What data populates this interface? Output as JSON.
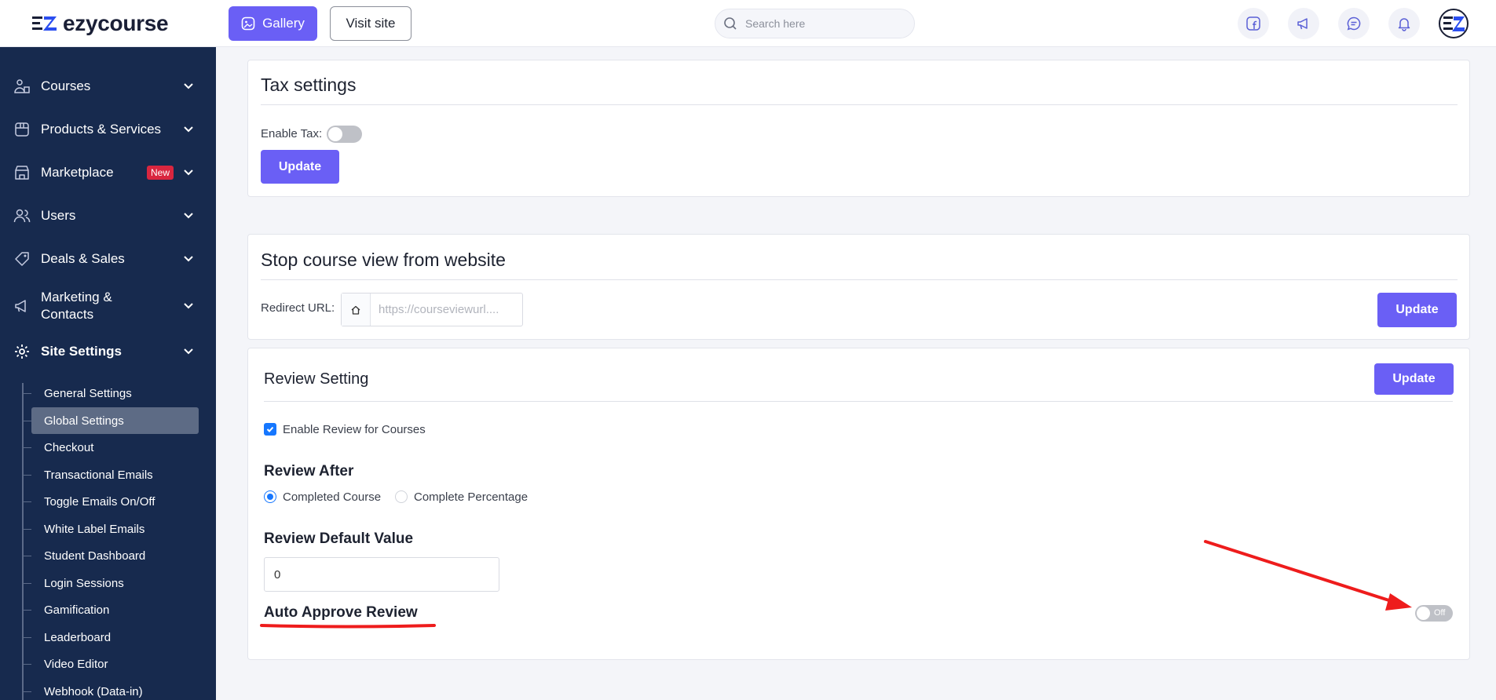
{
  "brand": {
    "name": "ezycourse"
  },
  "topbar": {
    "gallery_label": "Gallery",
    "visit_site_label": "Visit site",
    "search_placeholder": "Search here"
  },
  "sidebar": {
    "items": [
      {
        "label": "Courses",
        "icon": "courses-icon"
      },
      {
        "label": "Products & Services",
        "icon": "box-icon"
      },
      {
        "label": "Marketplace",
        "icon": "store-icon",
        "badge": "New"
      },
      {
        "label": "Users",
        "icon": "users-icon"
      },
      {
        "label": "Deals & Sales",
        "icon": "tag-icon"
      },
      {
        "label": "Marketing & Contacts",
        "icon": "megaphone-icon"
      },
      {
        "label": "Site Settings",
        "icon": "gear-icon"
      }
    ],
    "sub_items": [
      "General Settings",
      "Global Settings",
      "Checkout",
      "Transactional Emails",
      "Toggle Emails On/Off",
      "White Label Emails",
      "Student Dashboard",
      "Login Sessions",
      "Gamification",
      "Leaderboard",
      "Video Editor",
      "Webhook (Data-in)"
    ],
    "active_sub_item": "Global Settings"
  },
  "tax": {
    "title": "Tax settings",
    "enable_label": "Enable Tax:",
    "enabled": false,
    "update_label": "Update"
  },
  "stop_view": {
    "title": "Stop course view from website",
    "redirect_label": "Redirect URL:",
    "redirect_placeholder": "https://courseviewurl....",
    "update_label": "Update"
  },
  "review": {
    "title": "Review Setting",
    "update_label": "Update",
    "enable_label": "Enable Review for Courses",
    "enable_checked": true,
    "review_after_heading": "Review After",
    "options": [
      "Completed Course",
      "Complete Percentage"
    ],
    "selected_option": "Completed Course",
    "default_value_heading": "Review Default Value",
    "default_value": "0",
    "auto_approve_heading": "Auto Approve Review",
    "auto_approve_state": "Off"
  },
  "colors": {
    "primary": "#6a5ff5",
    "sidebar_bg": "#172a4e",
    "annotation": "#ee1c1c"
  }
}
